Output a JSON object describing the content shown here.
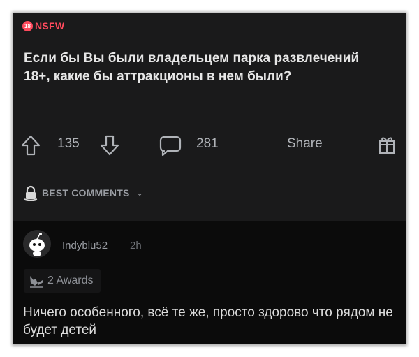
{
  "post": {
    "nsfw_badge": "18",
    "nsfw_label": "NSFW",
    "title": "Если бы Вы были владельцем парка развлечений 18+, какие бы аттракционы в нем были?"
  },
  "actions": {
    "score": "135",
    "comment_count": "281",
    "share_label": "Share"
  },
  "sort": {
    "label": "BEST COMMENTS"
  },
  "comment": {
    "username": "Indyblu52",
    "age": "2h",
    "awards_label": "2 Awards",
    "body": "Ничего особенного, всё те же, просто здорово что рядом не будет детей"
  },
  "icons": [
    "upvote-icon",
    "downvote-icon",
    "comment-icon",
    "gift-icon",
    "lock-icon",
    "chevron-down-icon",
    "award-icon",
    "avatar-icon"
  ],
  "colors": {
    "nsfw": "#ff4a5d",
    "post_bg": "#1a1a1b",
    "page_bg": "#0b0b0b",
    "muted_text": "#9a9da3"
  }
}
